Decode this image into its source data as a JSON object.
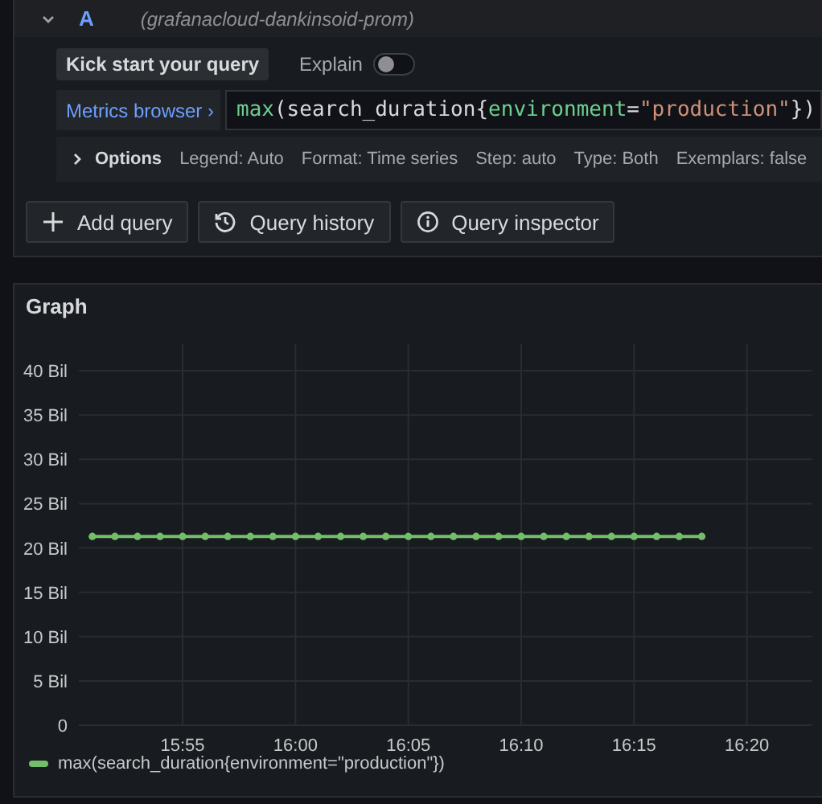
{
  "query": {
    "expanded": true,
    "ref_id": "A",
    "datasource": "(grafanacloud-dankinsoid-prom)",
    "kick_start": "Kick start your query",
    "explain": {
      "label": "Explain",
      "on": false
    },
    "metrics_browser": "Metrics browser ›",
    "expression": [
      {
        "text": "max",
        "kind": "function"
      },
      {
        "text": "(search_duration{",
        "kind": "plain"
      },
      {
        "text": "environment",
        "kind": "label"
      },
      {
        "text": "=",
        "kind": "plain"
      },
      {
        "text": "\"production\"",
        "kind": "string"
      },
      {
        "text": "})",
        "kind": "plain"
      }
    ],
    "options": {
      "expanded": false,
      "title": "Options",
      "items": [
        "Legend: Auto",
        "Format: Time series",
        "Step: auto",
        "Type: Both",
        "Exemplars: false"
      ]
    }
  },
  "actions": [
    {
      "label": "Add query"
    },
    {
      "label": "Query history"
    },
    {
      "label": "Query inspector"
    }
  ],
  "graph": {
    "title": "Graph",
    "chart_data": {
      "type": "line",
      "categories": [
        null,
        null,
        null,
        null,
        null,
        "15:55",
        null,
        null,
        null,
        null,
        "16:00",
        null,
        null,
        null,
        null,
        "16:05",
        null,
        null,
        null,
        null,
        "16:10",
        null,
        null,
        null,
        null,
        "16:15",
        null,
        null,
        null,
        null,
        "16:20"
      ],
      "grid": true,
      "series": [
        {
          "name": "max(search_duration{environment=\"production\"})",
          "color": "#73bf69",
          "marker": true,
          "values": [
            null,
            21.3,
            21.3,
            21.3,
            21.3,
            21.3,
            21.3,
            21.3,
            21.3,
            21.3,
            21.3,
            21.3,
            21.3,
            21.3,
            21.3,
            21.3,
            21.3,
            21.3,
            21.3,
            21.3,
            21.3,
            21.3,
            21.3,
            21.3,
            21.3,
            21.3,
            21.3,
            21.3,
            21.3,
            null,
            null
          ]
        }
      ],
      "ylim": [
        0,
        43
      ],
      "yticks": [
        {
          "value": 0,
          "label": "0"
        },
        {
          "value": 5,
          "label": "5 Bil"
        },
        {
          "value": 10,
          "label": "10 Bil"
        },
        {
          "value": 15,
          "label": "15 Bil"
        },
        {
          "value": 20,
          "label": "20 Bil"
        },
        {
          "value": 25,
          "label": "25 Bil"
        },
        {
          "value": 30,
          "label": "30 Bil"
        },
        {
          "value": 35,
          "label": "35 Bil"
        },
        {
          "value": 40,
          "label": "40 Bil"
        }
      ]
    }
  }
}
